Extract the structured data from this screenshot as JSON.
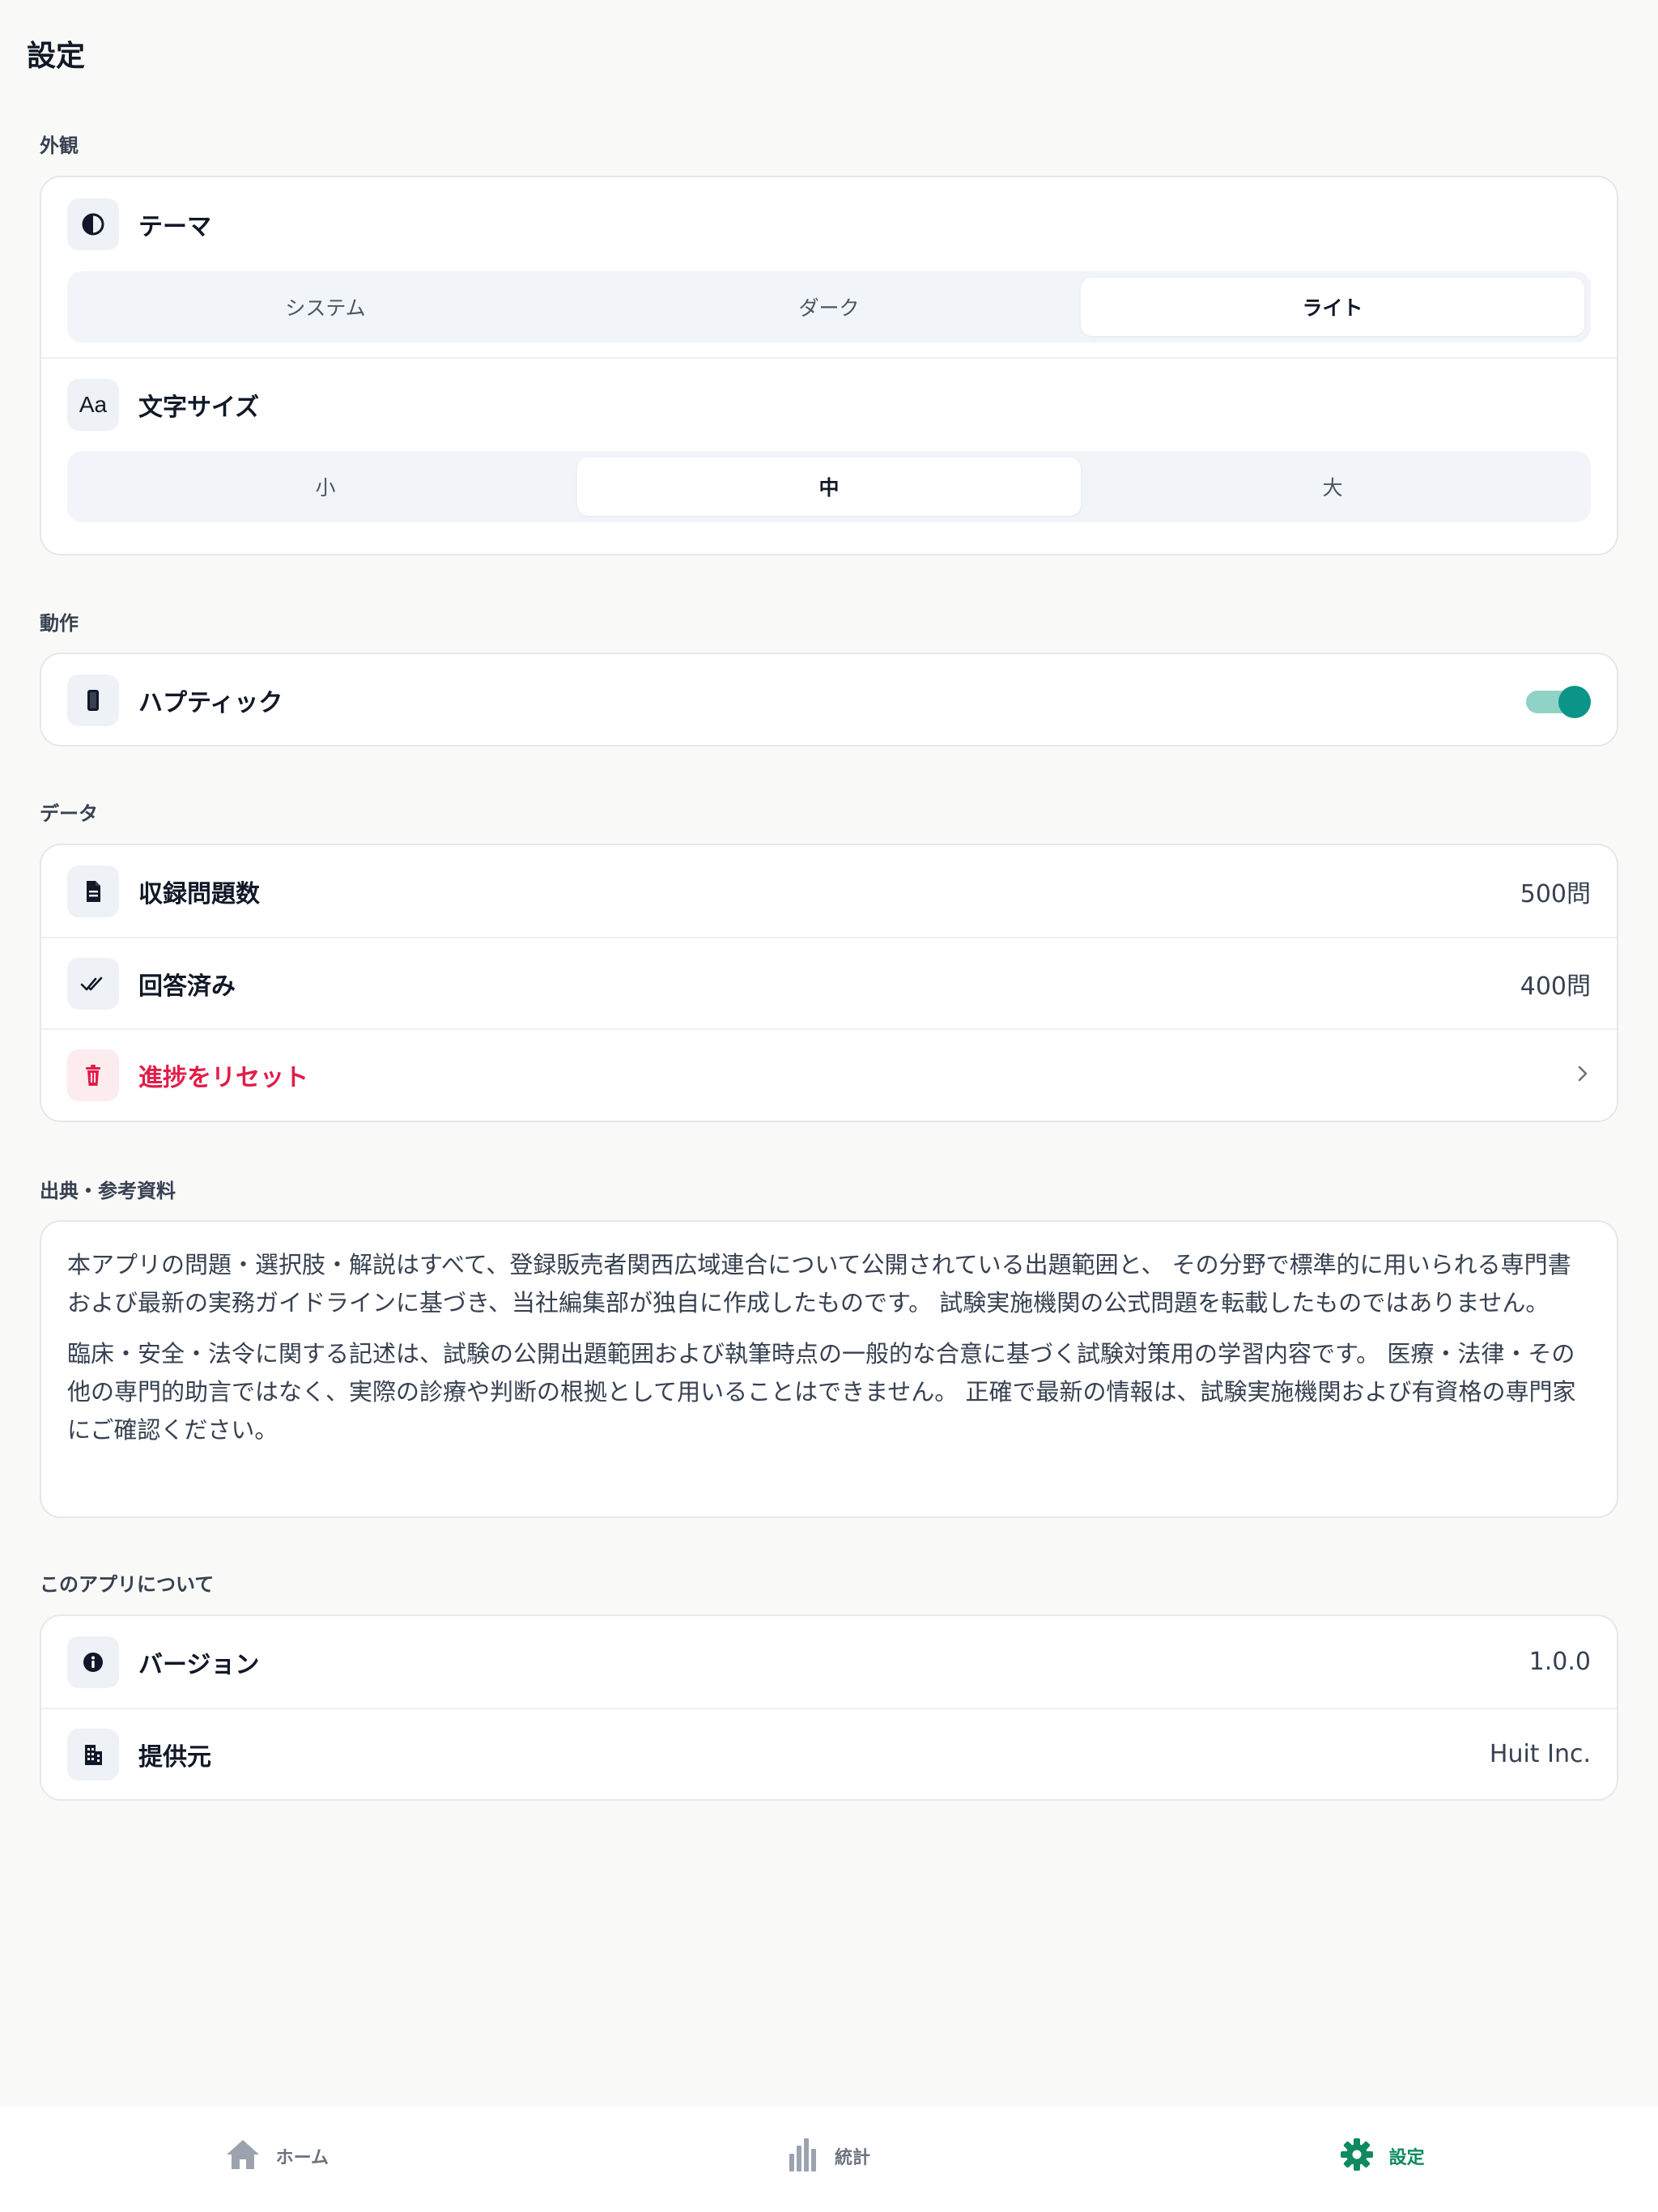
{
  "header": {
    "title": "設定"
  },
  "appearance": {
    "section_label": "外観",
    "theme": {
      "label": "テーマ",
      "icon": "contrast-icon",
      "options": [
        "システム",
        "ダーク",
        "ライト"
      ],
      "selected": "ライト"
    },
    "font_size": {
      "label": "文字サイズ",
      "icon_text": "Aa",
      "options": [
        "小",
        "中",
        "大"
      ],
      "selected": "中"
    }
  },
  "behavior": {
    "section_label": "動作",
    "haptic": {
      "label": "ハプティック",
      "icon": "phone-icon",
      "enabled": true
    }
  },
  "data": {
    "section_label": "データ",
    "total_questions": {
      "label": "収録問題数",
      "value": "500問",
      "icon": "document-icon"
    },
    "answered": {
      "label": "回答済み",
      "value": "400問",
      "icon": "double-check-icon"
    },
    "reset": {
      "label": "進捗をリセット",
      "icon": "trash-icon"
    }
  },
  "sources": {
    "section_label": "出典・参考資料",
    "paragraphs": [
      "本アプリの問題・選択肢・解説はすべて、登録販売者関西広域連合について公開されている出題範囲と、 その分野で標準的に用いられる専門書および最新の実務ガイドラインに基づき、当社編集部が独自に作成したものです。 試験実施機関の公式問題を転載したものではありません。",
      "臨床・安全・法令に関する記述は、試験の公開出題範囲および執筆時点の一般的な合意に基づく試験対策用の学習内容です。 医療・法律・その他の専門的助言ではなく、実際の診療や判断の根拠として用いることはできません。 正確で最新の情報は、試験実施機関および有資格の専門家にご確認ください。"
    ]
  },
  "about": {
    "section_label": "このアプリについて",
    "version": {
      "label": "バージョン",
      "value": "1.0.0",
      "icon": "info-icon"
    },
    "provider": {
      "label": "提供元",
      "value": "Huit Inc.",
      "icon": "building-icon"
    }
  },
  "tabbar": {
    "items": [
      {
        "label": "ホーム",
        "icon": "home-icon",
        "active": false
      },
      {
        "label": "統計",
        "icon": "chart-icon",
        "active": false
      },
      {
        "label": "設定",
        "icon": "gear-icon",
        "active": true
      }
    ]
  },
  "colors": {
    "accent": "#0d9488",
    "tab_active": "#0f8a5f",
    "danger": "#e11d48",
    "background": "#f9f9f8"
  }
}
